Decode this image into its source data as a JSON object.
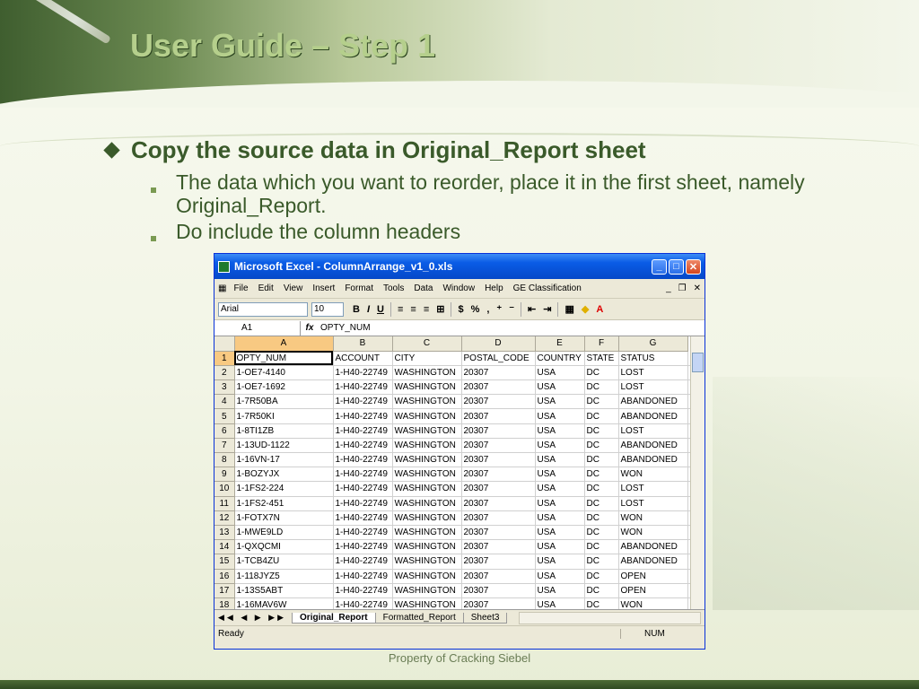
{
  "slide": {
    "title": "User Guide – Step 1",
    "bullet_main": "Copy the source data in Original_Report sheet",
    "sub_bullets": [
      "The data which you want to reorder, place it in the first sheet, namely Original_Report.",
      "Do include the column headers"
    ],
    "footer": "Property of Cracking Siebel"
  },
  "excel": {
    "window_title": "Microsoft Excel - ColumnArrange_v1_0.xls",
    "menu": [
      "File",
      "Edit",
      "View",
      "Insert",
      "Format",
      "Tools",
      "Data",
      "Window",
      "Help",
      "GE Classification"
    ],
    "font_name": "Arial",
    "font_size": "10",
    "name_box": "A1",
    "formula_value": "OPTY_NUM",
    "columns": [
      "A",
      "B",
      "C",
      "D",
      "E",
      "F",
      "G"
    ],
    "header_row": [
      "OPTY_NUM",
      "ACCOUNT",
      "CITY",
      "POSTAL_CODE",
      "COUNTRY",
      "STATE",
      "STATUS"
    ],
    "rows": [
      [
        "1-OE7-4140",
        "1-H40-22749",
        "WASHINGTON",
        "20307",
        "USA",
        "DC",
        "LOST"
      ],
      [
        "1-OE7-1692",
        "1-H40-22749",
        "WASHINGTON",
        "20307",
        "USA",
        "DC",
        "LOST"
      ],
      [
        "1-7R50BA",
        "1-H40-22749",
        "WASHINGTON",
        "20307",
        "USA",
        "DC",
        "ABANDONED"
      ],
      [
        "1-7R50KI",
        "1-H40-22749",
        "WASHINGTON",
        "20307",
        "USA",
        "DC",
        "ABANDONED"
      ],
      [
        "1-8TI1ZB",
        "1-H40-22749",
        "WASHINGTON",
        "20307",
        "USA",
        "DC",
        "LOST"
      ],
      [
        "1-13UD-1122",
        "1-H40-22749",
        "WASHINGTON",
        "20307",
        "USA",
        "DC",
        "ABANDONED"
      ],
      [
        "1-16VN-17",
        "1-H40-22749",
        "WASHINGTON",
        "20307",
        "USA",
        "DC",
        "ABANDONED"
      ],
      [
        "1-BOZYJX",
        "1-H40-22749",
        "WASHINGTON",
        "20307",
        "USA",
        "DC",
        "WON"
      ],
      [
        "1-1FS2-224",
        "1-H40-22749",
        "WASHINGTON",
        "20307",
        "USA",
        "DC",
        "LOST"
      ],
      [
        "1-1FS2-451",
        "1-H40-22749",
        "WASHINGTON",
        "20307",
        "USA",
        "DC",
        "LOST"
      ],
      [
        "1-FOTX7N",
        "1-H40-22749",
        "WASHINGTON",
        "20307",
        "USA",
        "DC",
        "WON"
      ],
      [
        "1-MWE9LD",
        "1-H40-22749",
        "WASHINGTON",
        "20307",
        "USA",
        "DC",
        "WON"
      ],
      [
        "1-QXQCMI",
        "1-H40-22749",
        "WASHINGTON",
        "20307",
        "USA",
        "DC",
        "ABANDONED"
      ],
      [
        "1-TCB4ZU",
        "1-H40-22749",
        "WASHINGTON",
        "20307",
        "USA",
        "DC",
        "ABANDONED"
      ],
      [
        "1-118JYZ5",
        "1-H40-22749",
        "WASHINGTON",
        "20307",
        "USA",
        "DC",
        "OPEN"
      ],
      [
        "1-13S5ABT",
        "1-H40-22749",
        "WASHINGTON",
        "20307",
        "USA",
        "DC",
        "OPEN"
      ],
      [
        "1-16MAV6W",
        "1-H40-22749",
        "WASHINGTON",
        "20307",
        "USA",
        "DC",
        "WON"
      ]
    ],
    "sheet_tabs": [
      "Original_Report",
      "Formatted_Report",
      "Sheet3"
    ],
    "status_left": "Ready",
    "status_right": "NUM"
  }
}
